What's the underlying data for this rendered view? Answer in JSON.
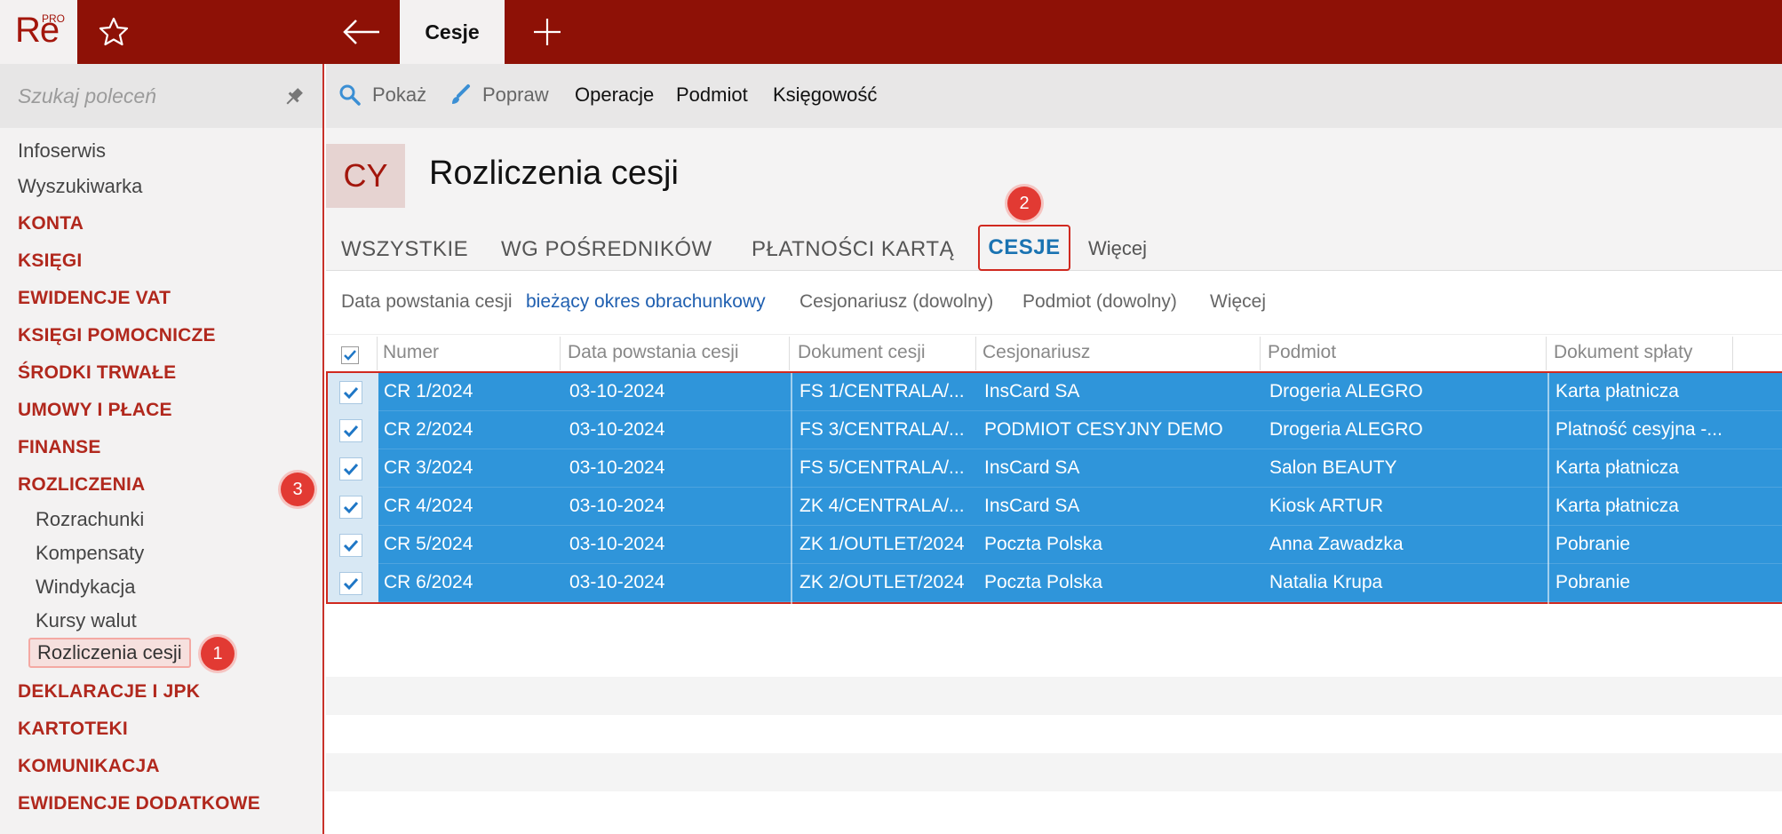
{
  "app": {
    "logo_text": "Re",
    "logo_sup": "PRO",
    "active_tab": "Cesje"
  },
  "sidebar": {
    "search_placeholder": "Szukaj poleceń",
    "top_items": [
      "Infoserwis",
      "Wyszukiwarka"
    ],
    "sections": [
      "KONTA",
      "KSIĘGI",
      "EWIDENCJE VAT",
      "KSIĘGI POMOCNICZE",
      "ŚRODKI TRWAŁE",
      "UMOWY I PŁACE",
      "FINANSE",
      "ROZLICZENIA"
    ],
    "sub_items": [
      "Rozrachunki",
      "Kompensaty",
      "Windykacja",
      "Kursy walut",
      "Rozliczenia cesji"
    ],
    "sections_after": [
      "DEKLARACJE I JPK",
      "KARTOTEKI",
      "KOMUNIKACJA",
      "EWIDENCJE DODATKOWE"
    ]
  },
  "toolbar": {
    "show": "Pokaż",
    "edit": "Popraw",
    "operations": "Operacje",
    "entity": "Podmiot",
    "accounting": "Księgowość"
  },
  "header": {
    "badge": "CY",
    "title": "Rozliczenia cesji"
  },
  "tabs": [
    "WSZYSTKIE",
    "WG POŚREDNIKÓW",
    "PŁATNOŚCI KARTĄ",
    "CESJE",
    "Więcej"
  ],
  "filters": {
    "date_label": "Data powstania cesji",
    "date_value": "bieżący okres obrachunkowy",
    "assignee": "Cesjonariusz (dowolny)",
    "entity": "Podmiot (dowolny)",
    "more": "Więcej"
  },
  "table": {
    "columns": [
      "Numer",
      "Data powstania cesji",
      "Dokument cesji",
      "Cesjonariusz",
      "Podmiot",
      "Dokument spłaty"
    ],
    "rows": [
      [
        "CR 1/2024",
        "03-10-2024",
        "FS 1/CENTRALA/...",
        "InsCard SA",
        "Drogeria ALEGRO",
        "Karta płatnicza"
      ],
      [
        "CR 2/2024",
        "03-10-2024",
        "FS 3/CENTRALA/...",
        "PODMIOT CESYJNY DEMO",
        "Drogeria ALEGRO",
        "Platność cesyjna -..."
      ],
      [
        "CR 3/2024",
        "03-10-2024",
        "FS 5/CENTRALA/...",
        "InsCard SA",
        "Salon BEAUTY",
        "Karta płatnicza"
      ],
      [
        "CR 4/2024",
        "03-10-2024",
        "ZK 4/CENTRALA/...",
        "InsCard SA",
        "Kiosk ARTUR",
        "Karta płatnicza"
      ],
      [
        "CR 5/2024",
        "03-10-2024",
        "ZK 1/OUTLET/2024",
        "Poczta Polska",
        "Anna Zawadzka",
        "Pobranie"
      ],
      [
        "CR 6/2024",
        "03-10-2024",
        "ZK 2/OUTLET/2024",
        "Poczta Polska",
        "Natalia Krupa",
        "Pobranie"
      ]
    ]
  },
  "markers": [
    "1",
    "2",
    "3"
  ],
  "colors": {
    "brand": "#8e1106",
    "section": "#b1281d",
    "selection": "#2f95da",
    "link": "#1f5fb0",
    "marker": "#e23a33"
  }
}
